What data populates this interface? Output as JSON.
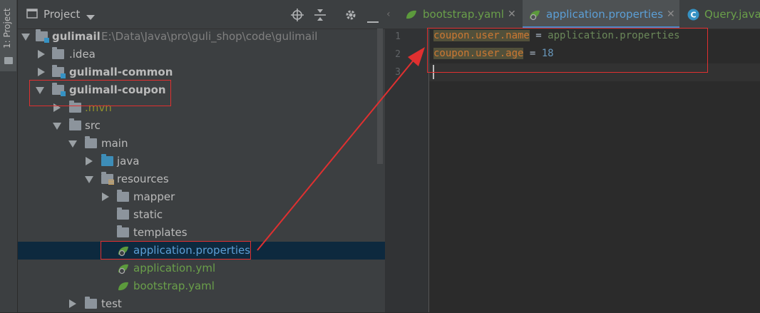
{
  "tool_window_tab": "1: Project",
  "project_panel": {
    "title": "Project",
    "tree": [
      {
        "label": "gulimail",
        "path": "E:\\Data\\Java\\pro\\guli_shop\\code\\gulimail"
      },
      {
        "label": ".idea"
      },
      {
        "label": "gulimall-common"
      },
      {
        "label": "gulimall-coupon"
      },
      {
        "label": ".mvn"
      },
      {
        "label": "src"
      },
      {
        "label": "main"
      },
      {
        "label": "java"
      },
      {
        "label": "resources"
      },
      {
        "label": "mapper"
      },
      {
        "label": "static"
      },
      {
        "label": "templates"
      },
      {
        "label": "application.properties"
      },
      {
        "label": "application.yml"
      },
      {
        "label": "bootstrap.yaml"
      },
      {
        "label": "test"
      }
    ]
  },
  "editor": {
    "tabs": [
      {
        "label": "bootstrap.yaml"
      },
      {
        "label": "application.properties"
      },
      {
        "label": "Query.java"
      }
    ],
    "line_numbers": [
      "1",
      "2",
      "3"
    ],
    "lines": [
      {
        "key": "coupon.user.name",
        "eq": " = ",
        "value": "application.properties"
      },
      {
        "key": "coupon.user.age",
        "eq": " = ",
        "value": "18"
      }
    ]
  },
  "colors": {
    "annotation": "#e03030",
    "selection": "#0d293e",
    "accent": "#4a88c7"
  }
}
